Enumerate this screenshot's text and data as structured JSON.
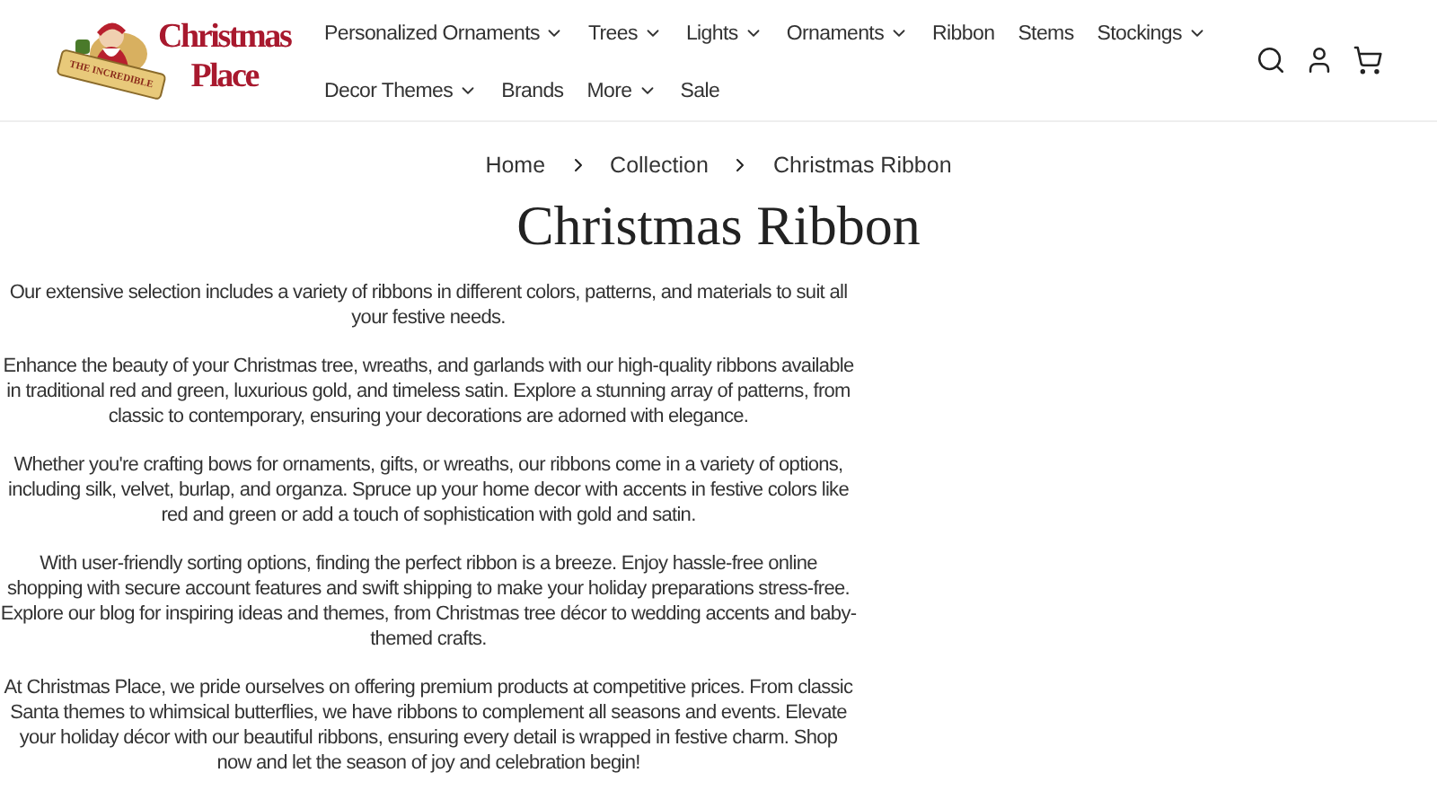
{
  "logo": {
    "tagline": "THE INCREDIBLE",
    "line_1": "Christmas",
    "line_2": "Place"
  },
  "nav": [
    {
      "label": "Personalized Ornaments",
      "has_menu": true
    },
    {
      "label": "Trees",
      "has_menu": true
    },
    {
      "label": "Lights",
      "has_menu": true
    },
    {
      "label": "Ornaments",
      "has_menu": true
    },
    {
      "label": "Ribbon",
      "has_menu": false
    },
    {
      "label": "Stems",
      "has_menu": false
    },
    {
      "label": "Stockings",
      "has_menu": true
    },
    {
      "label": "Decor Themes",
      "has_menu": true
    },
    {
      "label": "Brands",
      "has_menu": false
    },
    {
      "label": "More",
      "has_menu": true
    },
    {
      "label": "Sale",
      "has_menu": false
    }
  ],
  "breadcrumb": [
    "Home",
    "Collection",
    "Christmas Ribbon"
  ],
  "title": "Christmas Ribbon",
  "paragraphs": [
    "Our extensive selection includes a variety of ribbons in different colors, patterns, and materials to suit all your festive needs.",
    "Enhance the beauty of your Christmas tree, wreaths, and garlands with our high-quality ribbons available in traditional red and green, luxurious gold, and timeless satin. Explore a stunning array of patterns, from classic to contemporary, ensuring your decorations are adorned with elegance.",
    "Whether you're crafting bows for ornaments, gifts, or wreaths, our ribbons come in a variety of options, including silk, velvet, burlap, and organza. Spruce up your home decor with accents in festive colors like red and green or add a touch of sophistication with gold and satin.",
    "With user-friendly sorting options, finding the perfect ribbon is a breeze. Enjoy hassle-free online shopping with secure account features and swift shipping to make your holiday preparations stress-free. Explore our blog for inspiring ideas and themes, from Christmas tree décor to wedding accents and baby-themed crafts.",
    "At Christmas Place, we pride ourselves on offering premium products at competitive prices. From classic Santa themes to whimsical butterflies, we have ribbons to complement all seasons and events. Elevate your holiday décor with our beautiful ribbons, ensuring every detail is wrapped in festive charm. Shop now and let the season of joy and celebration begin!"
  ]
}
